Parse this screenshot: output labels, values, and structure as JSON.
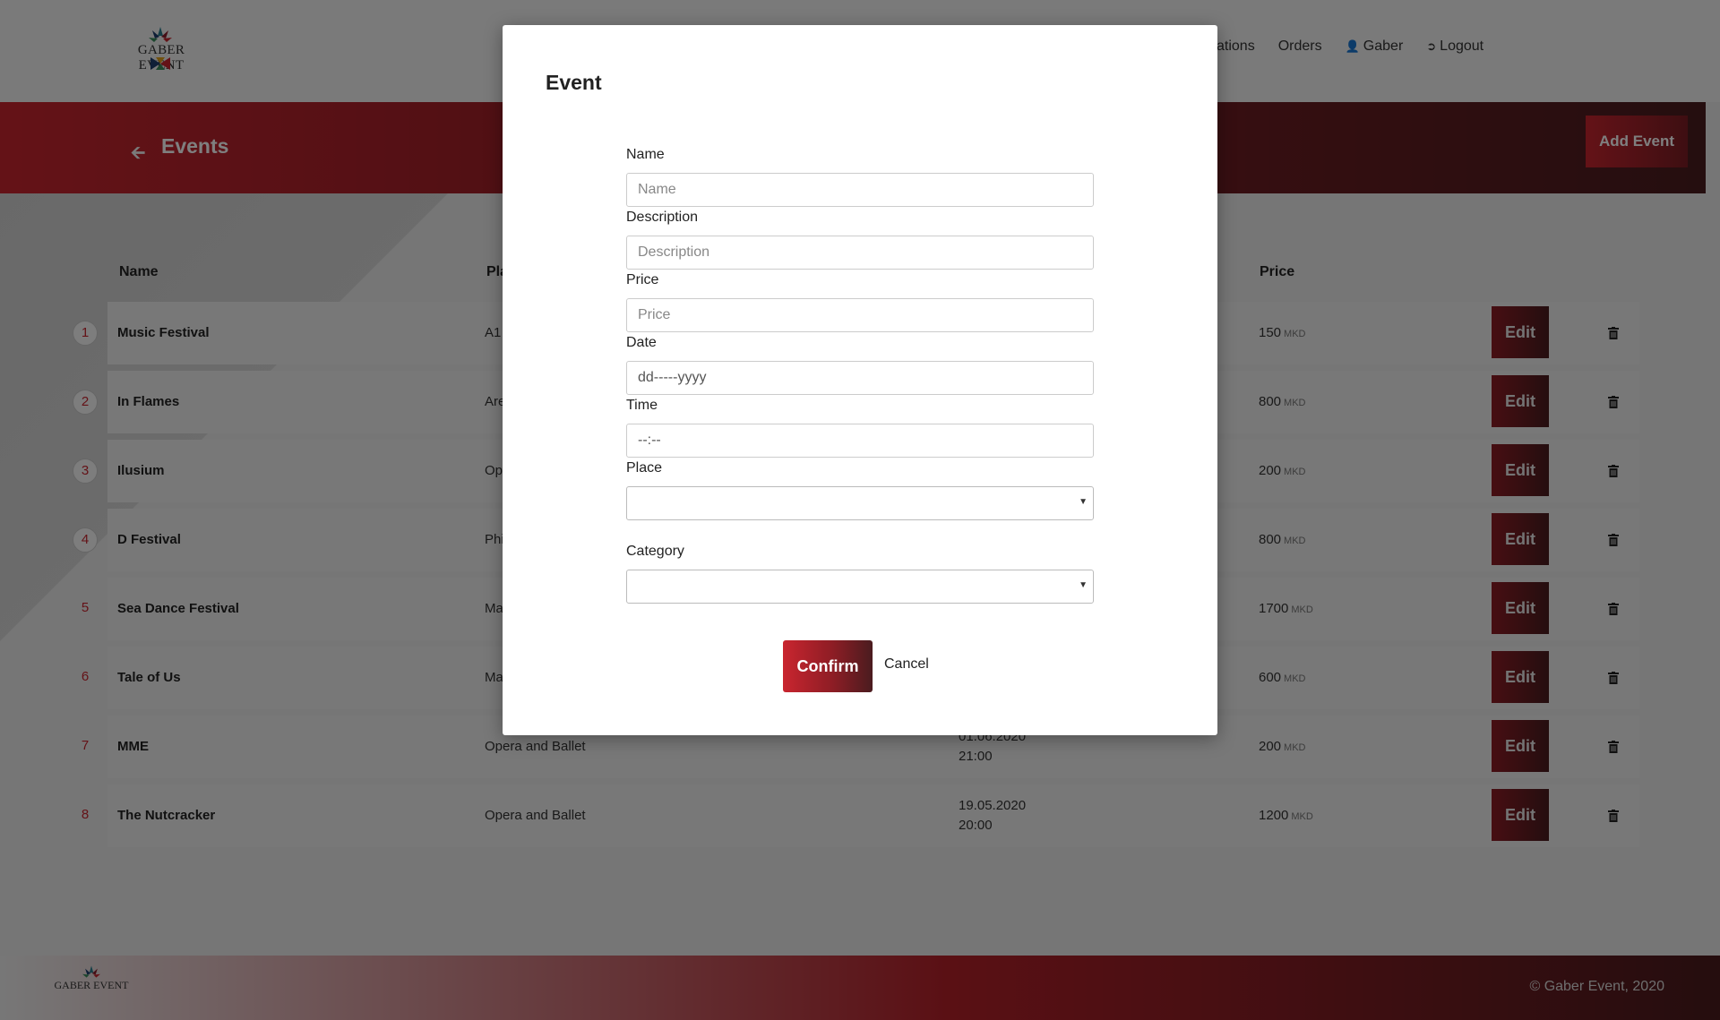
{
  "brand": {
    "logo_text": "GABER EVENT",
    "footer_logo_text": "GABER EVENT",
    "copyright": "© Gaber Event, 2020"
  },
  "nav": {
    "items": [
      "cations",
      "Orders",
      "Gaber",
      "Logout"
    ]
  },
  "banner": {
    "title": "Events",
    "add_label": "Add Event"
  },
  "table": {
    "columns": {
      "name": "Name",
      "place": "Pla",
      "price": "Price"
    },
    "currency": "MKD",
    "edit_label": "Edit",
    "rows": [
      {
        "num": "1",
        "name": "Music Festival",
        "place": "A1",
        "date": "",
        "time": "",
        "price": "150"
      },
      {
        "num": "2",
        "name": "In Flames",
        "place": "Are",
        "date": "",
        "time": "",
        "price": "800"
      },
      {
        "num": "3",
        "name": "Ilusium",
        "place": "Op",
        "date": "",
        "time": "",
        "price": "200"
      },
      {
        "num": "4",
        "name": "D Festival",
        "place": "Phi",
        "date": "",
        "time": "",
        "price": "800"
      },
      {
        "num": "5",
        "name": "Sea Dance Festival",
        "place": "Ma",
        "date": "",
        "time": "",
        "price": "1700"
      },
      {
        "num": "6",
        "name": "Tale of Us",
        "place": "Ma",
        "date": "",
        "time": "",
        "price": "600"
      },
      {
        "num": "7",
        "name": "MME",
        "place": "Opera and Ballet",
        "date": "01.06.2020",
        "time": "21:00",
        "price": "200"
      },
      {
        "num": "8",
        "name": "The Nutcracker",
        "place": "Opera and Ballet",
        "date": "19.05.2020",
        "time": "20:00",
        "price": "1200"
      }
    ]
  },
  "modal": {
    "title": "Event",
    "fields": {
      "name": {
        "label": "Name",
        "placeholder": "Name"
      },
      "description": {
        "label": "Description",
        "placeholder": "Description"
      },
      "price": {
        "label": "Price",
        "placeholder": "Price"
      },
      "date": {
        "label": "Date",
        "placeholder": "dd-----yyyy"
      },
      "time": {
        "label": "Time",
        "placeholder": "--:--"
      },
      "place": {
        "label": "Place",
        "value": ""
      },
      "category": {
        "label": "Category",
        "value": ""
      }
    },
    "confirm_label": "Confirm",
    "cancel_label": "Cancel"
  },
  "colors": {
    "accent": "#c9252f",
    "accent_dark": "#4a1c1f"
  }
}
